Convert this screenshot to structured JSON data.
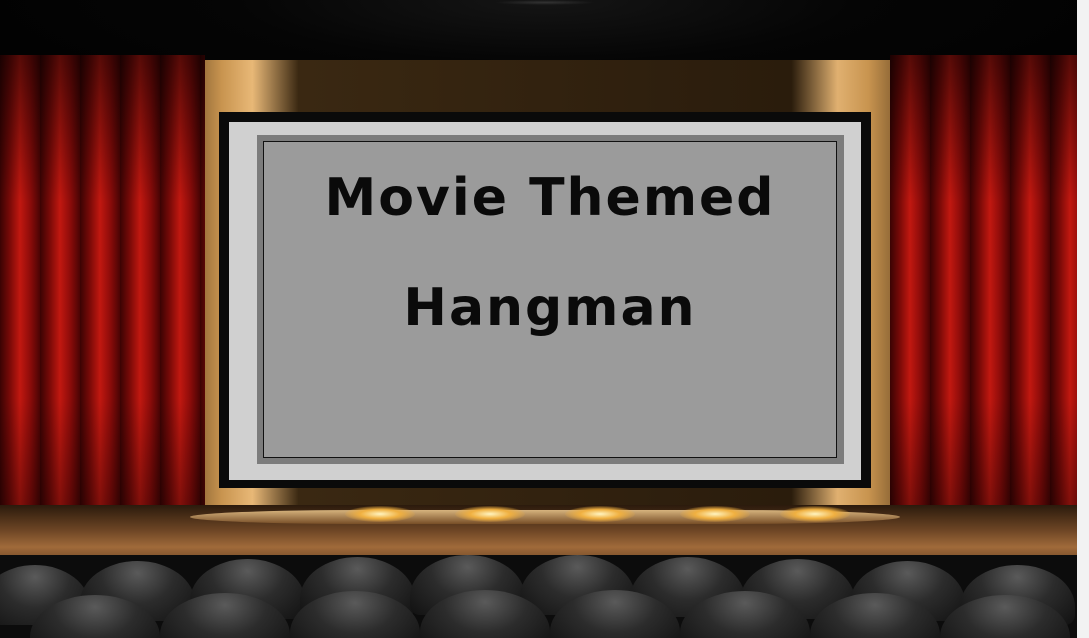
{
  "game": {
    "title_line1": "Movie Themed",
    "title_line2": "Hangman"
  },
  "colors": {
    "curtain": "#c11810",
    "screen": "#9b9b9b",
    "screen_border": "#d0d0d0",
    "title_text": "#0a0a0a"
  }
}
